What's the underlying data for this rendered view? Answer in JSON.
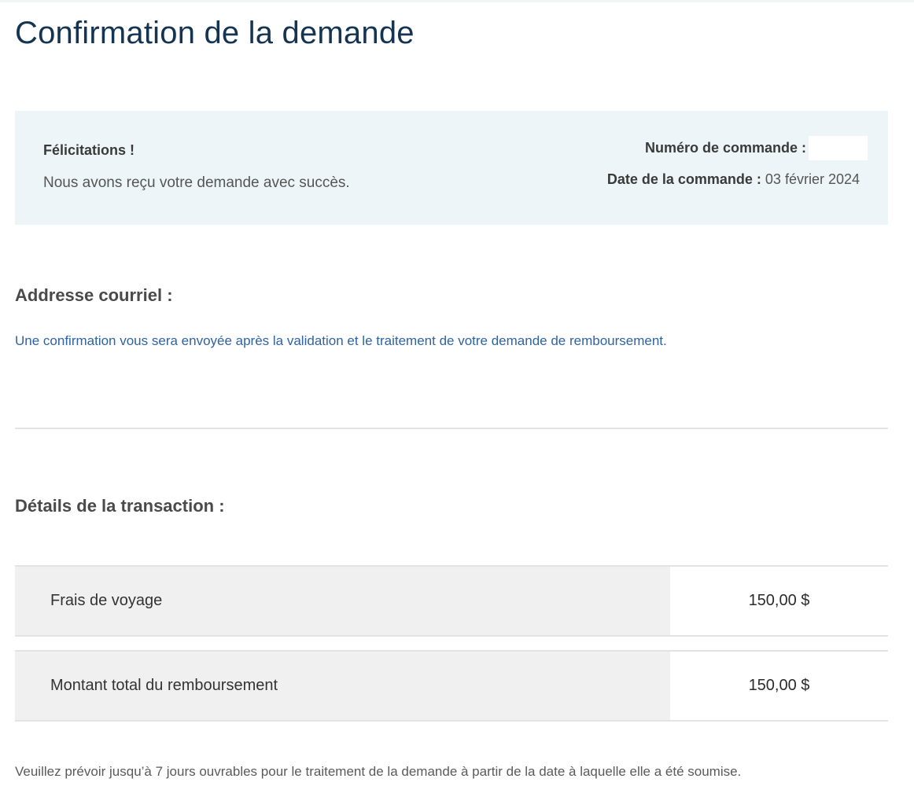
{
  "page": {
    "title": "Confirmation de la demande"
  },
  "confirmation": {
    "congrats": "Félicitations !",
    "received": "Nous avons reçu votre demande avec succès.",
    "order_number_label": "Numéro de commande :",
    "order_number_value": "",
    "order_date_label": "Date de la commande :",
    "order_date_value": "03 février 2024"
  },
  "email_section": {
    "title": "Addresse courriel :",
    "note": "Une confirmation vous sera envoyée après la validation et le traitement de votre demande de remboursement."
  },
  "transaction": {
    "title": "Détails de la transaction :",
    "rows": [
      {
        "label": "Frais de voyage",
        "amount": "150,00 $"
      },
      {
        "label": "Montant total du remboursement",
        "amount": "150,00 $"
      }
    ]
  },
  "footer": {
    "note": "Veuillez prévoir jusqu’à 7 jours ouvrables pour le traitement de la demande à partir de la date à laquelle elle a été soumise."
  },
  "colors": {
    "title": "#143451",
    "confirm_background": "#edf5f8",
    "link_text": "#2f63a2",
    "row_label_background": "#f0f0f0"
  }
}
